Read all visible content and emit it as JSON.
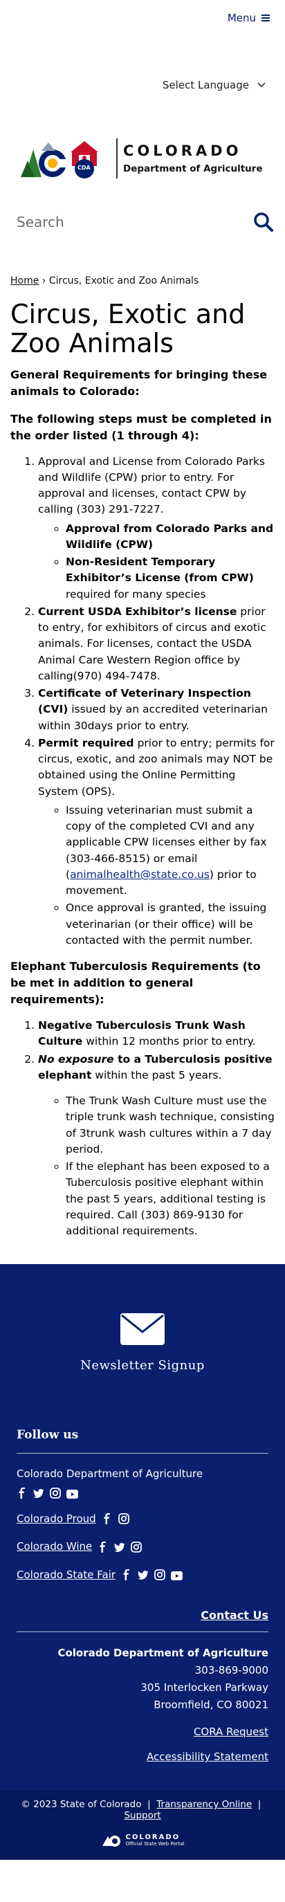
{
  "header": {
    "menu_label": "Menu",
    "language_label": "Select Language",
    "logo": {
      "name": "COLORADO",
      "department": "Department of Agriculture",
      "badge_text": "CDA",
      "colors": {
        "blue": "#002169",
        "red": "#c8102e",
        "gold": "#f6b000",
        "green": "#2e7d32"
      }
    },
    "search_placeholder": "Search"
  },
  "breadcrumb": {
    "home": "Home",
    "separator": "›",
    "current": "Circus, Exotic and Zoo Animals"
  },
  "page": {
    "title": "Circus, Exotic and Zoo Animals",
    "intro": "General Requirements for bringing these animals to Colorado:",
    "steps_title": "The following steps must be completed in the order listed (1 through 4):",
    "steps": [
      {
        "text": "Approval and License from Colorado Parks and Wildlife (CPW) prior to entry. For approval and licenses, contact CPW by calling (303) 291-7227.",
        "subs": [
          {
            "bold": "Approval from Colorado Parks and Wildlife (CPW)",
            "rest": ""
          },
          {
            "bold": "Non-Resident Temporary Exhibitor’s License (from CPW)",
            "rest": " required for many species"
          }
        ]
      },
      {
        "bold": "Current USDA Exhibitor’s license",
        "rest": " prior to entry, for exhibitors of circus and exotic animals. For licenses, contact the USDA Animal Care Western Region office by calling(970) 494-7478."
      },
      {
        "bold": "Certificate of Veterinary Inspection (CVI)",
        "rest": " issued by an accredited veterinarian within 30days prior to entry."
      },
      {
        "bold": "Permit required",
        "rest": " prior to entry; permits for circus, exotic, and zoo animals may NOT be obtained using the Online Permitting System (OPS).",
        "subs": [
          {
            "pre": "Issuing veterinarian must submit a copy of the completed CVI and any applicable CPW licenses either by fax (303-466-8515) or email (",
            "link": "animalhealth@state.co.us",
            "post": ") prior to movement."
          },
          {
            "pre": "Once approval is granted, the issuing veterinarian (or their office) will be contacted with the permit number."
          }
        ]
      }
    ],
    "elephant_title": "Elephant Tuberculosis Requirements (to be met in addition to general requirements):",
    "elephant_steps": [
      {
        "bold": "Negative Tuberculosis Trunk Wash Culture",
        "rest": " within 12 months prior to entry."
      },
      {
        "bold_italic": "No exposure",
        "bold": " to a Tuberculosis positive elephant",
        "rest": " within the past 5 years.",
        "subs": [
          "The Trunk Wash Culture must use the triple trunk wash technique, consisting of 3trunk wash cultures within a 7 day period.",
          "If the elephant has been exposed to a Tuberculosis positive elephant within the past 5 years, additional testing is required. Call (303) 869-9130 for additional requirements."
        ]
      }
    ]
  },
  "footer": {
    "newsletter_label": "Newsletter Signup",
    "follow_title": "Follow us",
    "social": [
      {
        "name": "Colorado Department of Agriculture",
        "underline": false,
        "icons": [
          "facebook-icon",
          "twitter-icon",
          "instagram-icon",
          "youtube-icon"
        ]
      },
      {
        "name": "Colorado Proud",
        "underline": true,
        "icons": [
          "facebook-icon",
          "instagram-icon"
        ]
      },
      {
        "name": "Colorado Wine",
        "underline": true,
        "icons": [
          "facebook-icon",
          "twitter-icon",
          "instagram-icon"
        ]
      },
      {
        "name": "Colorado State Fair",
        "underline": true,
        "icons": [
          "facebook-icon",
          "twitter-icon",
          "instagram-icon",
          "youtube-icon"
        ]
      }
    ],
    "contact_us": "Contact Us",
    "org": "Colorado Department of Agriculture",
    "phone": "303-869-9000",
    "street": "305 Interlocken Parkway",
    "city": "Broomfield, CO 80021",
    "cora": "CORA Request",
    "accessibility": "Accessibility Statement",
    "copyright": "© 2023 State of Colorado",
    "sep": "|",
    "transparency": "Transparency Online",
    "support": "Support",
    "portal_name": "COLORADO",
    "portal_sub": "Official State Web Portal",
    "colors": {
      "bg": "#0a1f6d",
      "bottom_bg": "#08185c"
    }
  }
}
